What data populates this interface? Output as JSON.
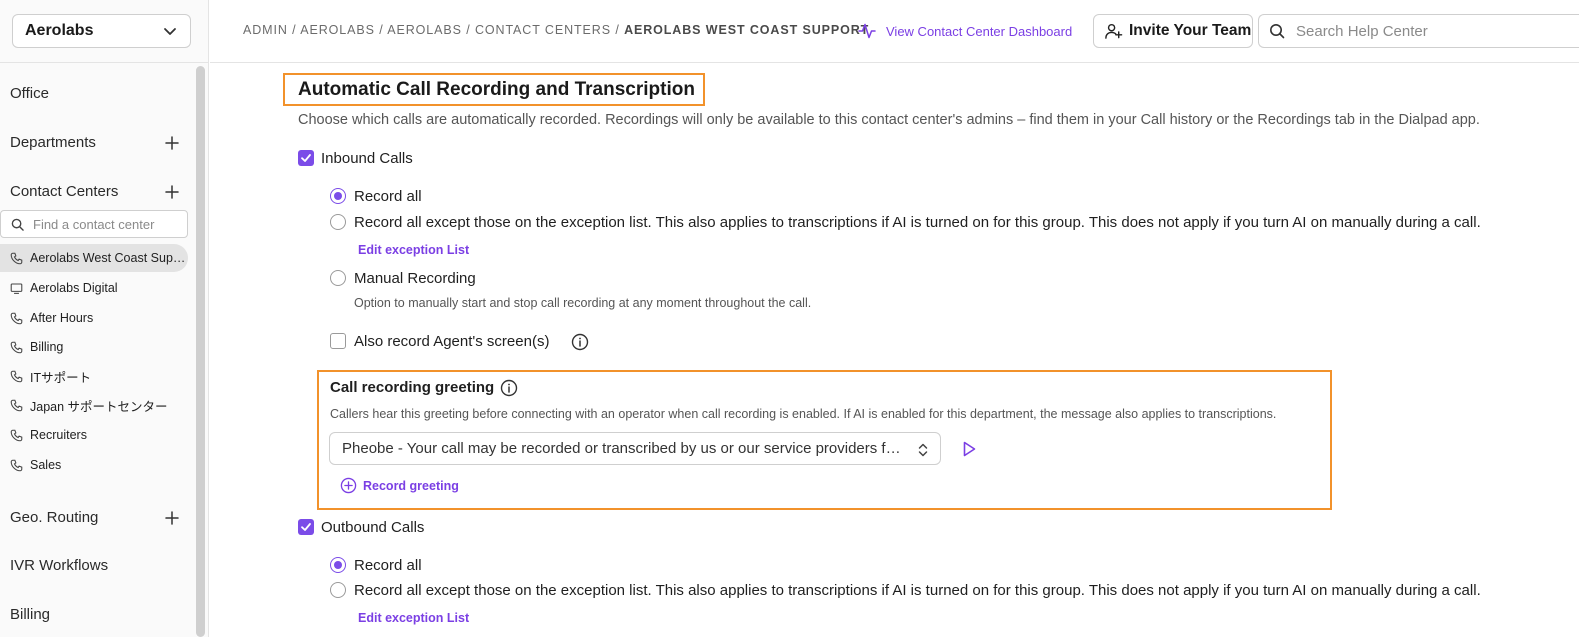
{
  "sidebar": {
    "org_name": "Aerolabs",
    "office": "Office",
    "departments": "Departments",
    "contact_centers": "Contact Centers",
    "search_placeholder": "Find a contact center",
    "items": [
      {
        "label": "Aerolabs West Coast Support",
        "icon": "phone-icon",
        "active": true
      },
      {
        "label": "Aerolabs Digital",
        "icon": "monitor-icon",
        "active": false
      },
      {
        "label": "After Hours",
        "icon": "phone-icon",
        "active": false
      },
      {
        "label": "Billing",
        "icon": "phone-icon",
        "active": false
      },
      {
        "label": "ITサポート",
        "icon": "phone-icon",
        "active": false
      },
      {
        "label": "Japan サポートセンター",
        "icon": "phone-icon",
        "active": false
      },
      {
        "label": "Recruiters",
        "icon": "phone-icon",
        "active": false
      },
      {
        "label": "Sales",
        "icon": "phone-icon",
        "active": false
      }
    ],
    "geo_routing": "Geo. Routing",
    "ivr_workflows": "IVR Workflows",
    "billing": "Billing"
  },
  "header": {
    "breadcrumb": [
      "ADMIN",
      "AEROLABS",
      "AEROLABS",
      "CONTACT CENTERS"
    ],
    "breadcrumb_current": "AEROLABS WEST COAST SUPPORT",
    "dashboard_link": "View Contact Center Dashboard",
    "invite_label": "Invite Your Team",
    "search_placeholder": "Search Help Center"
  },
  "recording": {
    "title": "Automatic Call Recording and Transcription",
    "description": "Choose which calls are automatically recorded. Recordings will only be available to this contact center's admins – find them in your Call history or the Recordings tab in the Dialpad app.",
    "inbound_label": "Inbound Calls",
    "inbound_checked": true,
    "record_all": "Record all",
    "record_except": "Record all except those on the exception list. This also applies to transcriptions if AI is turned on for this group. This does not apply if you turn AI on manually during a call.",
    "edit_exception": "Edit exception List",
    "manual_recording": "Manual Recording",
    "manual_desc": "Option to manually start and stop call recording at any moment throughout the call.",
    "agent_screen": "Also record Agent's screen(s)",
    "agent_screen_checked": false,
    "outbound_label": "Outbound Calls",
    "outbound_checked": true,
    "accent_color": "#7b4ce8",
    "highlight_color": "#f2922b"
  },
  "greeting": {
    "title": "Call recording greeting",
    "description": "Callers hear this greeting before connecting with an operator when call recording is enabled. If AI is enabled for this department, the message also applies to transcriptions.",
    "selected": "Pheobe - Your call may be recorded or transcribed by us or our service providers for quality assurance",
    "record_label": "Record greeting"
  }
}
